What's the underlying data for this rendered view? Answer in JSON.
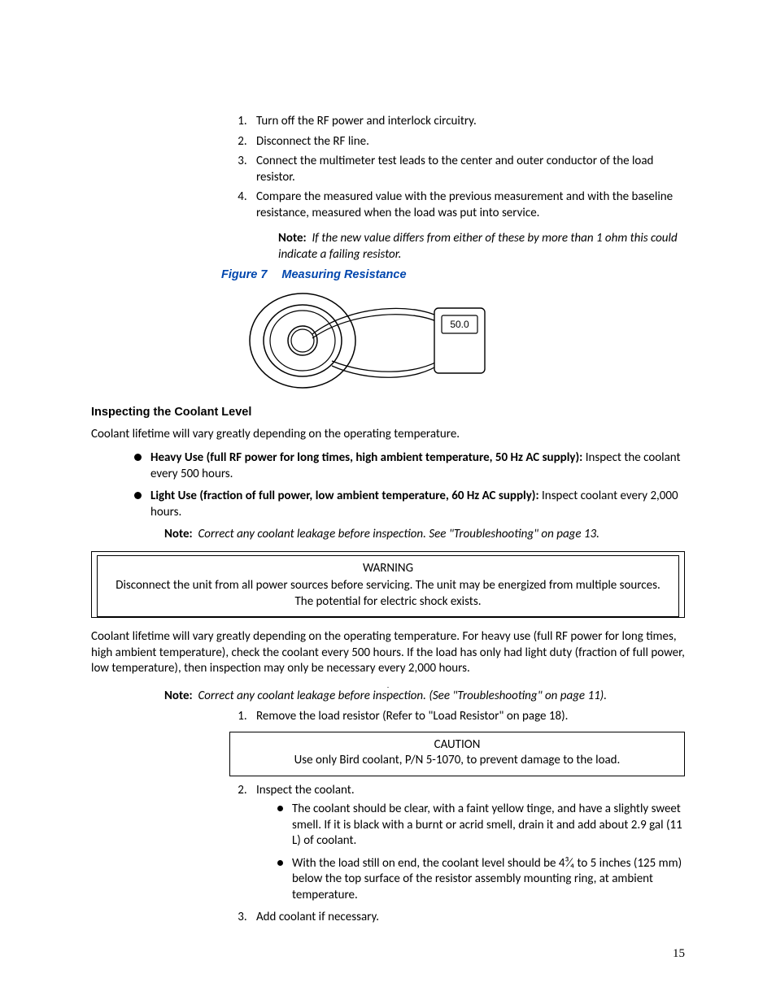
{
  "steps_a": [
    "Turn off the RF power and interlock circuitry.",
    "Disconnect the RF line.",
    "Connect the multimeter test leads to the center and outer conductor of the load resistor.",
    "Compare the measured value with the previous measurement and with the baseline resistance, measured when the load was put into service."
  ],
  "note1": {
    "label": "Note:",
    "text": "If the new value differs from either of these by more than 1 ohm this could indicate a failing resistor."
  },
  "figure": {
    "label": "Figure 7",
    "title": "Measuring Resistance",
    "display_value": "50.0"
  },
  "subhead1": "Inspecting the Coolant Level",
  "para1": "Coolant lifetime will vary greatly depending on the operating temperature.",
  "use_list": [
    {
      "bold": "Heavy Use (full RF power for long times, high ambient temperature, 50 Hz AC supply):",
      "rest": "Inspect the coolant every 500 hours."
    },
    {
      "bold": "Light Use (fraction of full power, low ambient temperature, 60 Hz AC supply):",
      "rest": "Inspect coolant every 2,000 hours."
    }
  ],
  "note2": {
    "label": "Note:",
    "text": "Correct any coolant leakage before inspection. See \"Troubleshooting\" on page 13."
  },
  "warning": {
    "title": "WARNING",
    "text": "Disconnect the unit from all power sources before servicing. The unit may be energized from multiple sources. The potential for electric shock exists."
  },
  "para2": "Coolant lifetime will vary greatly depending on the operating temperature. For heavy use (full RF power for long times, high ambient temperature), check the coolant every 500 hours. If the load has only had light duty (fraction of full power, low temperature), then inspection may only be necessary every 2,000 hours.",
  "note3": {
    "label": "Note:",
    "text": "Correct any coolant leakage before inspection. (See \"Troubleshooting\" on page 11)."
  },
  "steps_b": {
    "s1": "Remove the load resistor (Refer to \"Load Resistor\" on page 18).",
    "s2": "Inspect the coolant.",
    "s2_bullets": [
      "The coolant should be clear, with a faint yellow tinge, and have a slightly sweet smell. If it is black with a burnt or acrid smell, drain it and add about 2.9 gal (11 L) of coolant.",
      "With the load still on end, the coolant level should be 4³⁄₄ to 5 inches (125 mm) below the top surface of the resistor assembly mounting ring, at ambient temperature."
    ],
    "s3": "Add coolant if necessary."
  },
  "caution": {
    "title": "CAUTION",
    "text": "Use only Bird coolant, P/N 5-1070, to prevent damage to the load."
  },
  "page_number": "15"
}
